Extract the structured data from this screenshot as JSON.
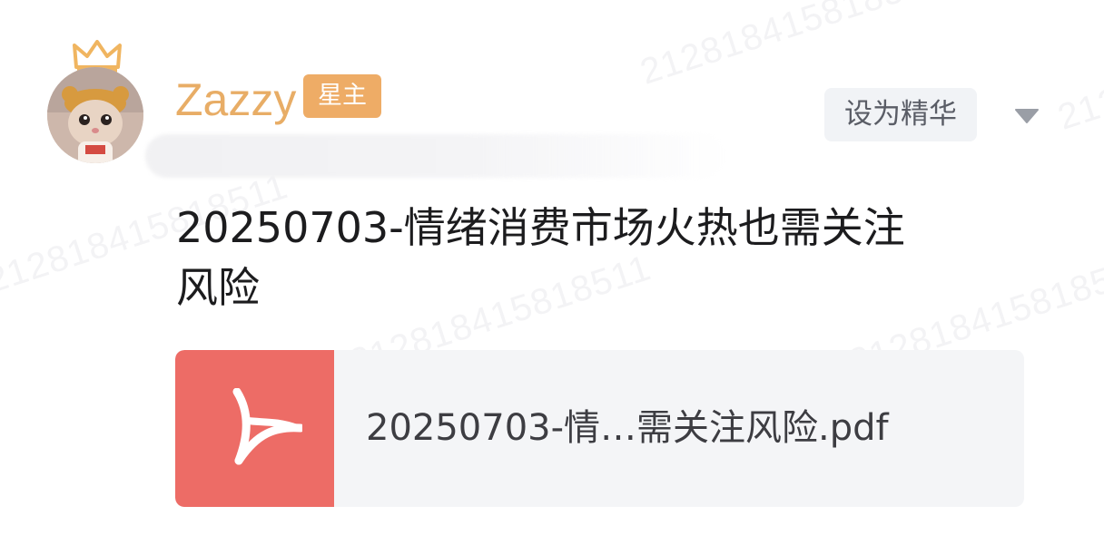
{
  "watermark": {
    "text": "212818415818511"
  },
  "post": {
    "author": {
      "name": "Zazzy",
      "role_badge": "星主",
      "avatar_icon": "cat-with-crown-avatar",
      "crown_icon": "crown-icon"
    },
    "actions": {
      "essence_label": "设为精华",
      "menu_icon": "chevron-down-icon"
    },
    "title_line1": "20250703-情绪消费市场火热也需关注",
    "title_line2": "风险",
    "attachment": {
      "file_name": "20250703-情…需关注风险.pdf",
      "icon": "pdf-icon"
    }
  },
  "colors": {
    "name": "#e8ad66",
    "badge": "#eeac66",
    "pdf_tile": "#ed6c66",
    "card_bg": "#f4f5f7"
  }
}
